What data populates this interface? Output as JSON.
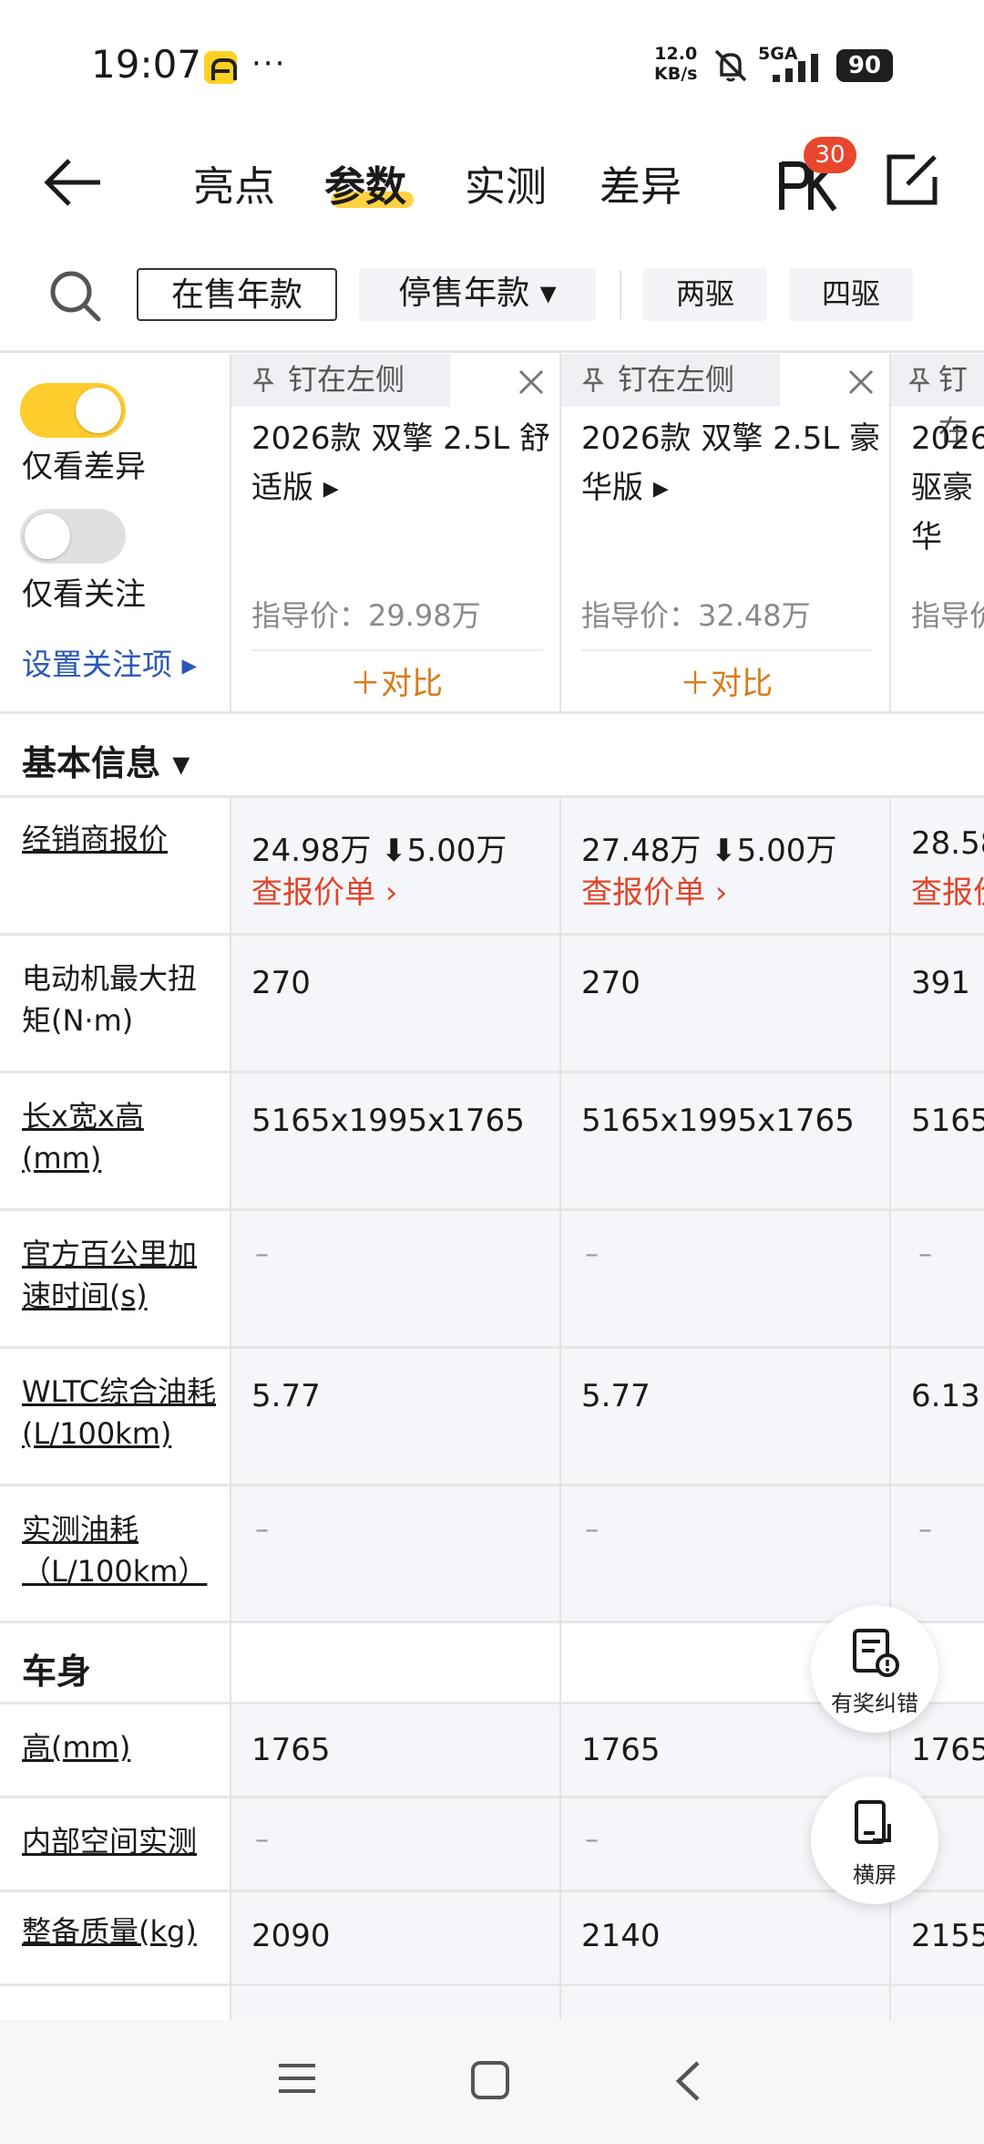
{
  "status_bar": {
    "time": "19:07",
    "more": "···",
    "net_speed": "12.0",
    "net_unit": "KB/s",
    "network": "5GA",
    "battery": "90"
  },
  "header": {
    "tabs": [
      {
        "label": "亮点"
      },
      {
        "label": "参数"
      },
      {
        "label": "实测"
      },
      {
        "label": "差异"
      }
    ],
    "active_tab": "参数",
    "pk_badge": "30"
  },
  "filters": {
    "on_sale": "在售年款",
    "stopped": "停售年款 ▾",
    "two_wd": "两驱",
    "four_wd": "四驱"
  },
  "left_panel": {
    "only_diff": "仅看差异",
    "only_follow": "仅看关注",
    "set_follow": "设置关注项 ▸"
  },
  "cars": [
    {
      "pin": "钉在左侧",
      "model": "2026款 双擎 2.5L 舒适版 ▸",
      "guide_price": "指导价：29.98万",
      "compare": "＋对比"
    },
    {
      "pin": "钉在左侧",
      "model": "2026款 双擎 2.5L 豪华版 ▸",
      "guide_price": "指导价：32.48万",
      "compare": "＋对比"
    },
    {
      "pin": "钉在",
      "model": "2026 驱豪华",
      "guide_price": "指导价"
    }
  ],
  "sections": {
    "basic": "基本信息 ▾",
    "body": "车身"
  },
  "basic_rows": [
    {
      "name": "经销商报价",
      "c1": "24.98万 ⬇5.00万",
      "c2": "27.48万 ⬇5.00万",
      "c3": "28.58",
      "link": "查报价单 ›",
      "link3": "查报价"
    },
    {
      "name": "电动机最大扭矩(N·m)",
      "c1": "270",
      "c2": "270",
      "c3": "391"
    },
    {
      "name": "长x宽x高(mm)",
      "c1": "5165x1995x1765",
      "c2": "5165x1995x1765",
      "c3": "5165x"
    },
    {
      "name": "官方百公里加速时间(s)",
      "c1": "–",
      "c2": "–",
      "c3": "–"
    },
    {
      "name": "WLTC综合油耗(L/100km)",
      "c1": "5.77",
      "c2": "5.77",
      "c3": "6.13"
    },
    {
      "name": "实测油耗（L/100km）",
      "c1": "–",
      "c2": "–",
      "c3": "–"
    }
  ],
  "body_rows": [
    {
      "name": "高(mm)",
      "c1": "1765",
      "c2": "1765",
      "c3": "1765"
    },
    {
      "name": "内部空间实测",
      "c1": "–",
      "c2": "–",
      "c3": ""
    },
    {
      "name": "整备质量(kg)",
      "c1": "2090",
      "c2": "2140",
      "c3": "2155"
    }
  ],
  "fabs": {
    "report": "有奖纠错",
    "landscape": "横屏"
  },
  "colors": {
    "accent_yellow": "#ffcc2e",
    "link_blue": "#2a58b8",
    "price_red": "#e0452a",
    "compare_orange": "#d97a1a",
    "badge_red": "#e8472e"
  }
}
